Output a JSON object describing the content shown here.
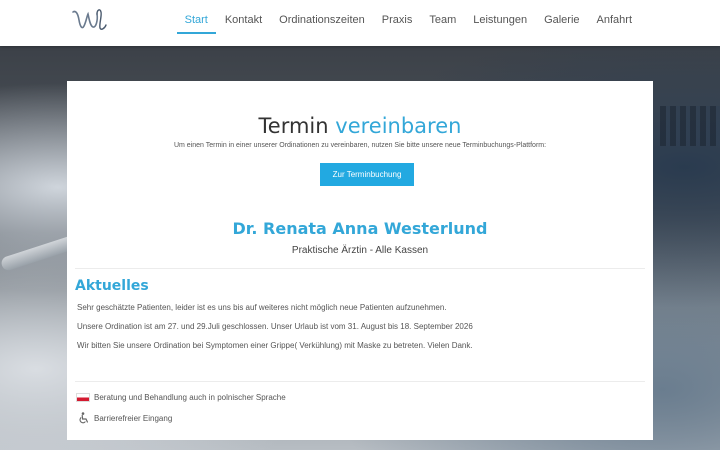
{
  "nav": {
    "items": [
      {
        "label": "Start",
        "active": true
      },
      {
        "label": "Kontakt",
        "active": false
      },
      {
        "label": "Ordinationszeiten",
        "active": false
      },
      {
        "label": "Praxis",
        "active": false
      },
      {
        "label": "Team",
        "active": false
      },
      {
        "label": "Leistungen",
        "active": false
      },
      {
        "label": "Galerie",
        "active": false
      },
      {
        "label": "Anfahrt",
        "active": false
      }
    ]
  },
  "booking": {
    "title_part1": "Termin",
    "title_part2": "vereinbaren",
    "description": "Um einen Termin in einer unserer Ordinationen zu vereinbaren, nutzen Sie bitte unsere neue Terminbuchungs-Plattform:",
    "button_label": "Zur Terminbuchung"
  },
  "doctor": {
    "name": "Dr. Renata Anna Westerlund",
    "specialty": "Praktische Ärztin - Alle Kassen"
  },
  "news": {
    "heading": "Aktuelles",
    "items": [
      "Sehr geschätzte Patienten, leider ist es uns bis auf weiteres nicht möglich neue Patienten aufzunehmen.",
      "Unsere Ordination ist am 27. und 29.Juli geschlossen. Unser Urlaub ist vom 31. August bis 18. September 2026",
      "Wir bitten Sie unsere Ordination bei Symptomen einer Grippe( Verkühlung) mit Maske zu betreten. Vielen Dank."
    ]
  },
  "info": {
    "polish_label": "Beratung und Behandlung auch in polnischer Sprache",
    "accessible_label": "Barrierefreier Eingang"
  },
  "colors": {
    "accent": "#33a7d8",
    "button": "#22a9e1"
  }
}
